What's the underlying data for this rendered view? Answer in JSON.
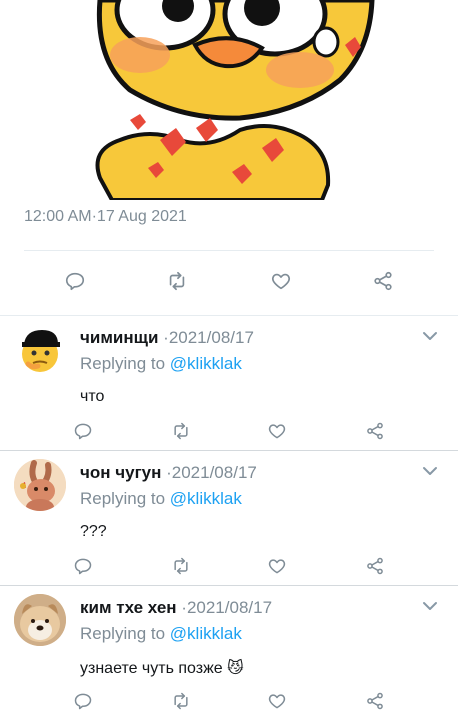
{
  "tweet": {
    "timestamp": "12:00 AM·17 Aug 2021",
    "media_icon": "cartoon-duck-character-image"
  },
  "action_icons": [
    "reply-icon",
    "retweet-icon",
    "like-icon",
    "share-icon"
  ],
  "replies": [
    {
      "name": "чиминщи",
      "date": "·2021/08/17",
      "replying_to": "Replying to",
      "handle": "@klikklak",
      "text": "что",
      "avatar_icon": "face-emoji-with-cap-avatar"
    },
    {
      "name": "чон чугун",
      "date": "·2021/08/17",
      "replying_to": "Replying to",
      "handle": "@klikklak",
      "text": "???",
      "avatar_icon": "cartoon-rabbit-avatar"
    },
    {
      "name": "ким тхе хен",
      "date": "·2021/08/17",
      "replying_to": "Replying to",
      "handle": "@klikklak",
      "text": "узнаете чуть позже 😼",
      "avatar_icon": "dog-photo-avatar"
    }
  ],
  "colors": {
    "secondary_text": "#7f8c96",
    "link": "#1da1f2",
    "primary_text": "#14171a",
    "divider": "#e6ecf0"
  }
}
